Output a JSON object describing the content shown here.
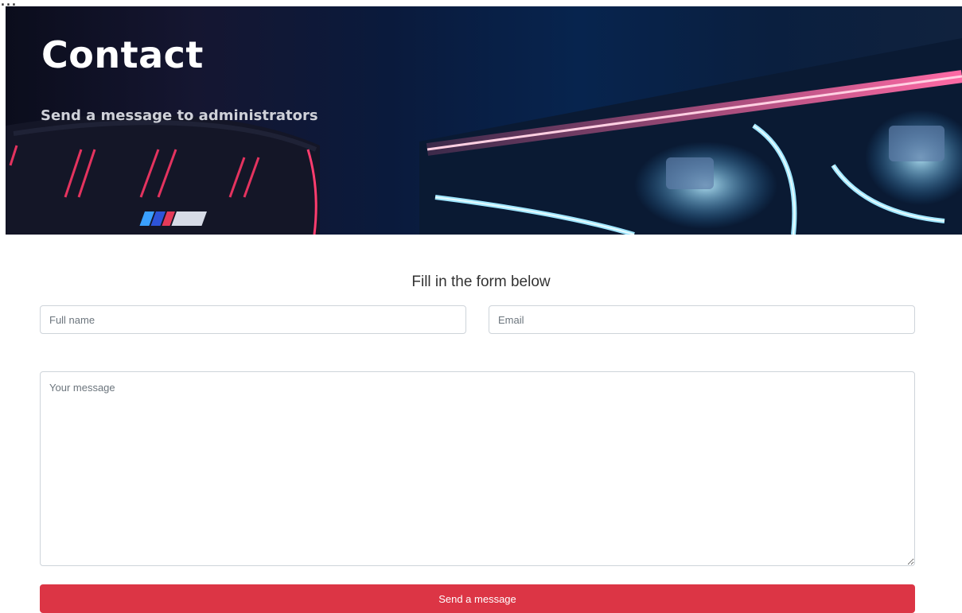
{
  "hero": {
    "title": "Contact",
    "subtitle": "Send a message to administrators",
    "image": "car-headlight-image"
  },
  "form": {
    "heading": "Fill in the form below",
    "name_placeholder": "Full name",
    "email_placeholder": "Email",
    "message_placeholder": "Your message",
    "submit_label": "Send a message"
  },
  "colors": {
    "button": "#dc3545",
    "hero_dark": "#0a1a3c",
    "headlight_accent": "#ff5fa2",
    "headlight_glow": "#7fd8ff"
  }
}
